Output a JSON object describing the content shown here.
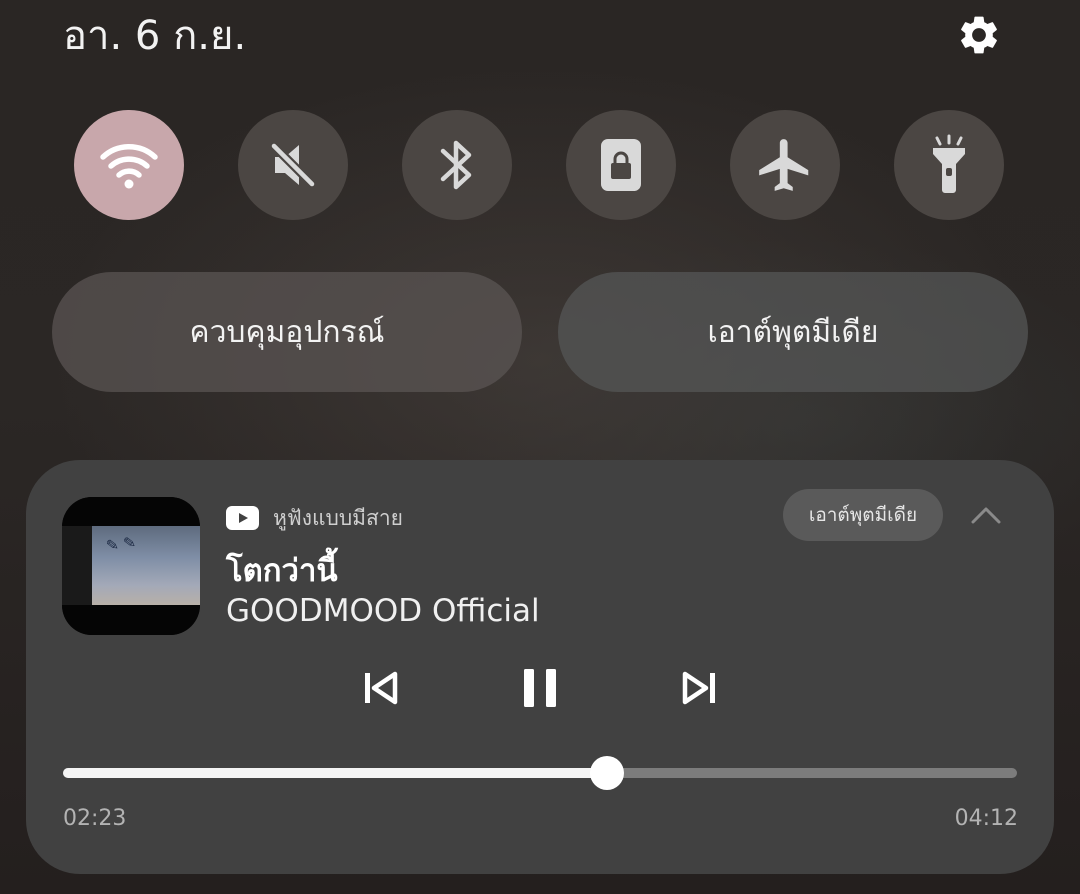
{
  "status": {
    "date": "อา. 6 ก.ย."
  },
  "header": {
    "settings_icon": "gear-icon"
  },
  "quick_tiles": [
    {
      "id": "wifi",
      "icon": "wifi-icon",
      "active": true
    },
    {
      "id": "sound",
      "icon": "mute-icon",
      "active": false
    },
    {
      "id": "bluetooth",
      "icon": "bluetooth-icon",
      "active": false
    },
    {
      "id": "lock",
      "icon": "screen-lock-icon",
      "active": false
    },
    {
      "id": "airplane",
      "icon": "airplane-icon",
      "active": false
    },
    {
      "id": "flashlight",
      "icon": "flashlight-icon",
      "active": false
    }
  ],
  "actions": {
    "device_control": "ควบคุมอุปกรณ์",
    "media_output": "เอาต์พุตมีเดีย"
  },
  "media": {
    "app_icon": "youtube-icon",
    "app_name": "หูฟังแบบมีสาย",
    "output_chip": "เอาต์พุตมีเดีย",
    "title": "โตกว่านี้",
    "artist": "GOODMOOD Official",
    "elapsed": "02:23",
    "duration": "04:12",
    "progress": 0.57
  },
  "colors": {
    "active_tile": "#c8a7ab",
    "tile": "#4b4643",
    "card": "#414141",
    "youtube_red": "#ffffff"
  }
}
